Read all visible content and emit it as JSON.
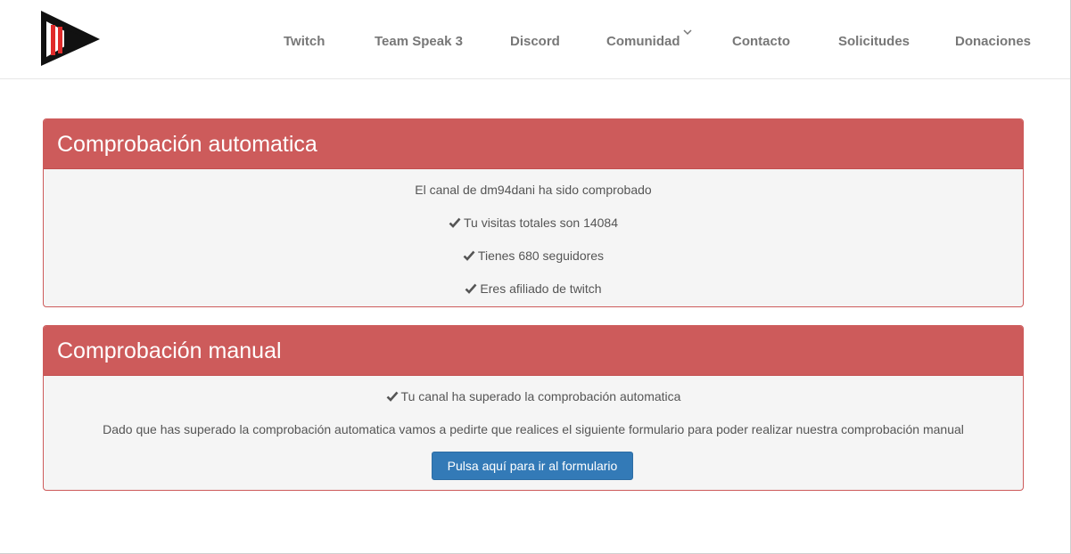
{
  "nav": {
    "items": [
      {
        "label": "Twitch"
      },
      {
        "label": "Team Speak 3"
      },
      {
        "label": "Discord"
      },
      {
        "label": "Comunidad"
      },
      {
        "label": "Contacto"
      },
      {
        "label": "Solicitudes"
      },
      {
        "label": "Donaciones"
      }
    ]
  },
  "auto_panel": {
    "title": "Comprobación automatica",
    "lines": [
      "El canal de dm94dani ha sido comprobado",
      "Tu visitas totales son 14084",
      "Tienes 680 seguidores",
      "Eres afiliado de twitch"
    ]
  },
  "manual_panel": {
    "title": "Comprobación manual",
    "passed_text": "Tu canal ha superado la comprobación automatica",
    "description": "Dado que has superado la comprobación automatica vamos a pedirte que realices el siguiente formulario para poder realizar nuestra comprobación manual",
    "button_label": "Pulsa aquí para ir al formulario"
  },
  "colors": {
    "panel_accent": "#cd5b5b",
    "button": "#337ab7"
  },
  "icons": {
    "logo": "play-logo",
    "check": "check-icon",
    "dropdown": "chevron-down-icon"
  }
}
